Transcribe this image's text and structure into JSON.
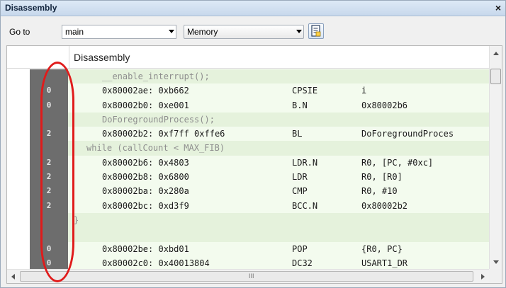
{
  "window": {
    "title": "Disassembly",
    "close_glyph": "×"
  },
  "toolbar": {
    "goto_label": "Go to",
    "goto_value": "main",
    "memory_value": "Memory",
    "button_icon": "document-icon"
  },
  "panel": {
    "header": "Disassembly"
  },
  "rows": [
    {
      "type": "src",
      "count": "",
      "text": "__enable_interrupt();",
      "indent": 1
    },
    {
      "type": "asm",
      "count": "0",
      "addr": "0x80002ae: 0xb662",
      "mn": "CPSIE",
      "op": "i"
    },
    {
      "type": "asm",
      "count": "0",
      "addr": "0x80002b0: 0xe001",
      "mn": "B.N",
      "op": "0x80002b6"
    },
    {
      "type": "src",
      "count": "",
      "text": "DoForegroundProcess();",
      "indent": 1
    },
    {
      "type": "asm",
      "count": "2",
      "addr": "0x80002b2: 0xf7ff 0xffe6",
      "mn": "BL",
      "op": "DoForegroundProces"
    },
    {
      "type": "src",
      "count": "",
      "text": "while (callCount < MAX_FIB)",
      "indent": 0
    },
    {
      "type": "asm",
      "count": "2",
      "addr": "0x80002b6: 0x4803",
      "mn": "LDR.N",
      "op": "R0, [PC, #0xc]"
    },
    {
      "type": "asm",
      "count": "2",
      "addr": "0x80002b8: 0x6800",
      "mn": "LDR",
      "op": "R0, [R0]"
    },
    {
      "type": "asm",
      "count": "2",
      "addr": "0x80002ba: 0x280a",
      "mn": "CMP",
      "op": "R0, #10"
    },
    {
      "type": "asm",
      "count": "2",
      "addr": "0x80002bc: 0xd3f9",
      "mn": "BCC.N",
      "op": "0x80002b2"
    },
    {
      "type": "src",
      "count": "",
      "text": "}",
      "indent": -1
    },
    {
      "type": "blank",
      "count": "",
      "text": ""
    },
    {
      "type": "asm",
      "count": "0",
      "addr": "0x80002be: 0xbd01",
      "mn": "POP",
      "op": "{R0, PC}"
    },
    {
      "type": "asm",
      "count": "0",
      "addr": "0x80002c0: 0x40013804",
      "mn": "DC32",
      "op": "USART1_DR"
    }
  ],
  "scrollbar": {
    "h_grip": "III"
  },
  "colors": {
    "annotation": "#e01b1b",
    "gutter": "#6d6d6d",
    "source_row_bg": "#e5f2dc",
    "asm_row_bg": "#f3fbee"
  }
}
